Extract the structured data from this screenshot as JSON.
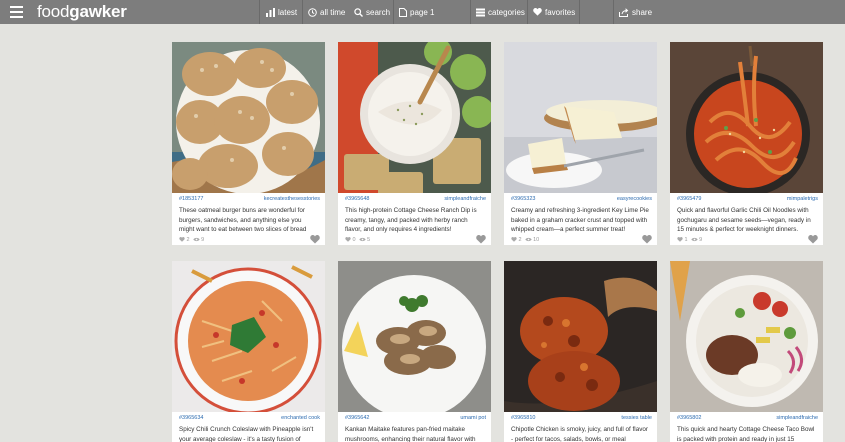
{
  "header": {
    "logo_light": "food",
    "logo_bold": "gawker",
    "nav": {
      "latest": "latest",
      "all_time": "all time",
      "search": "search",
      "page": "page 1",
      "categories": "categories",
      "favorites": "favorites",
      "share": "share"
    }
  },
  "cards": [
    {
      "id": "#1853177",
      "source": "kecreatesthesesstories",
      "desc": "These oatmeal burger buns are wonderful for burgers, sandwiches, and anything else you might want to eat between two slices of bread",
      "hearts": "2",
      "views": "9"
    },
    {
      "id": "#3965648",
      "source": "simpleandfraiche",
      "desc": "This high-protein Cottage Cheese Ranch Dip is creamy, tangy, and packed with herby ranch flavor, and only requires 4 ingredients!",
      "hearts": "0",
      "views": "5"
    },
    {
      "id": "#3965323",
      "source": "easyrecookies",
      "desc": "Creamy and refreshing 3-ingredient Key Lime Pie baked in a graham cracker crust and topped with whipped cream—a perfect summer treat!",
      "hearts": "2",
      "views": "10"
    },
    {
      "id": "#3965479",
      "source": "mimpaletrigs",
      "desc": "Quick and flavorful Garlic Chili Oil Noodles with gochugaru and sesame seeds—vegan, ready in 15 minutes & perfect for weeknight dinners.",
      "hearts": "1",
      "views": "9"
    },
    {
      "id": "#3965634",
      "source": "enchanted cook",
      "desc": "Spicy Chili Crunch Coleslaw with Pineapple isn't your average coleslaw - it's a tasty fusion of",
      "hearts": "",
      "views": ""
    },
    {
      "id": "#3965642",
      "source": "umami pot",
      "desc": "Kankan Maitake features pan-fried maitake mushrooms, enhancing their natural flavor with",
      "hearts": "",
      "views": ""
    },
    {
      "id": "#3965810",
      "source": "tessies table",
      "desc": "Chipotle Chicken is smoky, juicy, and full of flavor - perfect for tacos, salads, bowls, or meal",
      "hearts": "",
      "views": ""
    },
    {
      "id": "#3965802",
      "source": "simpleandfraiche",
      "desc": "This quick and hearty Cottage Cheese Taco Bowl is packed with protein and ready in just 15",
      "hearts": "",
      "views": ""
    }
  ]
}
